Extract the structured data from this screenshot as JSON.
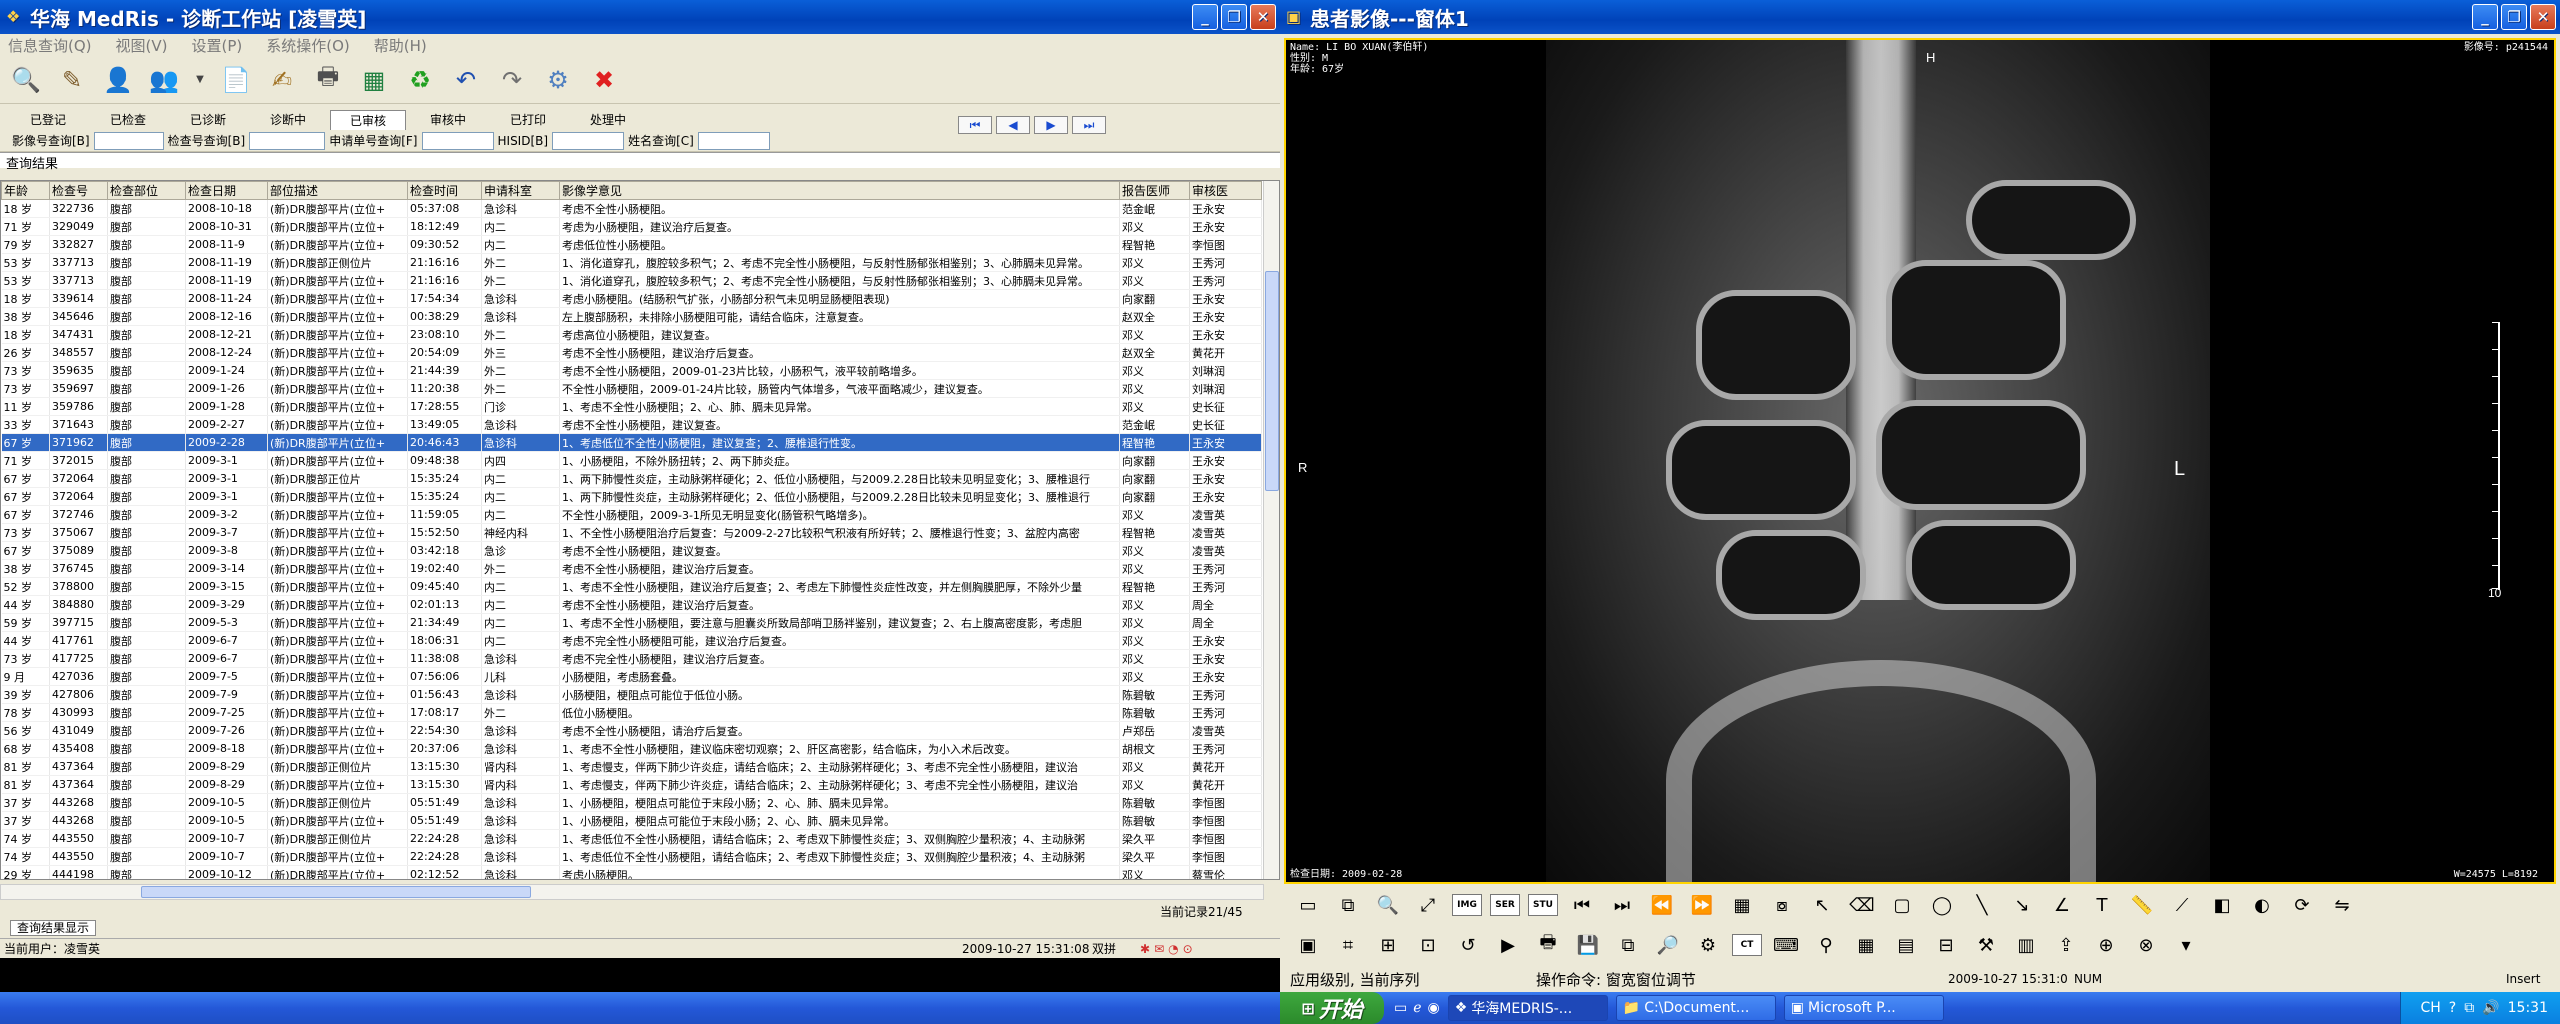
{
  "left_window": {
    "title": "华海 MedRis - 诊断工作站 [凌雪英]",
    "menu": [
      "信息查询(Q)",
      "视图(V)",
      "设置(P)",
      "系统操作(O)",
      "帮助(H)"
    ],
    "tabs": [
      "已登记",
      "已检查",
      "已诊断",
      "诊断中",
      "已审核",
      "审核中",
      "已打印",
      "处理中"
    ],
    "active_tab": "已审核",
    "search": {
      "label1": "影像号查询[B]",
      "label2": "检查号查询[B]",
      "label3": "申请单号查询[F]",
      "label4": "HISID[B]",
      "label5": "姓名查询[C]"
    },
    "result_label": "查询结果",
    "columns": [
      "年龄",
      "检查号",
      "检查部位",
      "检查日期",
      "部位描述",
      "检查时间",
      "申请科室",
      "影像学意见",
      "报告医师",
      "审核医"
    ],
    "rows": [
      [
        "18 岁",
        "322736",
        "腹部",
        "2008-10-18",
        "(新)DR腹部平片(立位+",
        "05:37:08",
        "急诊科",
        "考虑不全性小肠梗阻。",
        "范金岷",
        "王永安"
      ],
      [
        "71 岁",
        "329049",
        "腹部",
        "2008-10-31",
        "(新)DR腹部平片(立位+",
        "18:12:49",
        "内二",
        "考虑为小肠梗阻，建议治疗后复查。",
        "邓义",
        "王永安"
      ],
      [
        "79 岁",
        "332827",
        "腹部",
        "2008-11-9",
        "(新)DR腹部平片(立位+",
        "09:30:52",
        "内二",
        "考虑低位性小肠梗阻。",
        "程智艳",
        "李恒图"
      ],
      [
        "53 岁",
        "337713",
        "腹部",
        "2008-11-19",
        "(新)DR腹部正侧位片",
        "21:16:16",
        "外二",
        "1、消化道穿孔，腹腔较多积气；2、考虑不完全性小肠梗阻，与反射性肠郁张相鉴别；3、心肺膈未见异常。",
        "邓义",
        "王秀河"
      ],
      [
        "53 岁",
        "337713",
        "腹部",
        "2008-11-19",
        "(新)DR腹部平片(立位+",
        "21:16:16",
        "外二",
        "1、消化道穿孔，腹腔较多积气；2、考虑不完全性小肠梗阻，与反射性肠郁张相鉴别；3、心肺膈未见异常。",
        "邓义",
        "王秀河"
      ],
      [
        "18 岁",
        "339614",
        "腹部",
        "2008-11-24",
        "(新)DR腹部平片(立位+",
        "17:54:34",
        "急诊科",
        "考虑小肠梗阻。(结肠积气扩张，小肠部分积气未见明显肠梗阻表现)",
        "向家翻",
        "王永安"
      ],
      [
        "38 岁",
        "345646",
        "腹部",
        "2008-12-16",
        "(新)DR腹部平片(立位+",
        "00:38:29",
        "急诊科",
        "左上腹部肠积，未排除小肠梗阻可能，请结合临床，注意复查。",
        "赵双全",
        "王永安"
      ],
      [
        "18 岁",
        "347431",
        "腹部",
        "2008-12-21",
        "(新)DR腹部平片(立位+",
        "23:08:10",
        "外二",
        "考虑高位小肠梗阻，建议复查。",
        "邓义",
        "王永安"
      ],
      [
        "26 岁",
        "348557",
        "腹部",
        "2008-12-24",
        "(新)DR腹部平片(立位+",
        "20:54:09",
        "外三",
        "考虑不全性小肠梗阻，建议治疗后复查。",
        "赵双全",
        "黄花开"
      ],
      [
        "73 岁",
        "359635",
        "腹部",
        "2009-1-24",
        "(新)DR腹部平片(立位+",
        "21:44:39",
        "外二",
        "考虑不全性小肠梗阻，2009-01-23片比较，小肠积气，液平较前略增多。",
        "邓义",
        "刘琳润"
      ],
      [
        "73 岁",
        "359697",
        "腹部",
        "2009-1-26",
        "(新)DR腹部平片(立位+",
        "11:20:38",
        "外二",
        "不全性小肠梗阻，2009-01-24片比较，肠管内气体增多，气液平面略减少，建议复查。",
        "邓义",
        "刘琳润"
      ],
      [
        "11 岁",
        "359786",
        "腹部",
        "2009-1-28",
        "(新)DR腹部平片(立位+",
        "17:28:55",
        "门诊",
        "1、考虑不全性小肠梗阻；2、心、肺、膈未见异常。",
        "邓义",
        "史长征"
      ],
      [
        "33 岁",
        "371643",
        "腹部",
        "2009-2-27",
        "(新)DR腹部平片(立位+",
        "13:49:05",
        "急诊科",
        "考虑不全性小肠梗阻，建议复查。",
        "范金岷",
        "史长征"
      ],
      [
        "67 岁",
        "371962",
        "腹部",
        "2009-2-28",
        "(新)DR腹部平片(立位+",
        "20:46:43",
        "急诊科",
        "1、考虑低位不全性小肠梗阻，建议复查；2、腰椎退行性变。",
        "程智艳",
        "王永安"
      ],
      [
        "71 岁",
        "372015",
        "腹部",
        "2009-3-1",
        "(新)DR腹部平片(立位+",
        "09:48:38",
        "内四",
        "1、小肠梗阻，不除外肠扭转；2、两下肺炎症。",
        "向家翻",
        "王永安"
      ],
      [
        "67 岁",
        "372064",
        "腹部",
        "2009-3-1",
        "(新)DR腹部正位片",
        "15:35:24",
        "内二",
        "1、两下肺慢性炎症，主动脉粥样硬化；2、低位小肠梗阻，与2009.2.28日比较未见明显变化；3、腰椎退行",
        "向家翻",
        "王永安"
      ],
      [
        "67 岁",
        "372064",
        "腹部",
        "2009-3-1",
        "(新)DR腹部平片(立位+",
        "15:35:24",
        "内二",
        "1、两下肺慢性炎症，主动脉粥样硬化；2、低位小肠梗阻，与2009.2.28日比较未见明显变化；3、腰椎退行",
        "向家翻",
        "王永安"
      ],
      [
        "67 岁",
        "372746",
        "腹部",
        "2009-3-2",
        "(新)DR腹部平片(立位+",
        "11:59:05",
        "内二",
        "不全性小肠梗阻，2009-3-1所见无明显变化(肠管积气略增多)。",
        "邓义",
        "凌雪英"
      ],
      [
        "73 岁",
        "375067",
        "腹部",
        "2009-3-7",
        "(新)DR腹部平片(立位+",
        "15:52:50",
        "神经内科",
        "1、不全性小肠梗阻治疗后复查：与2009-2-27比较积气积液有所好转；2、腰椎退行性变；3、盆腔内高密",
        "程智艳",
        "凌雪英"
      ],
      [
        "67 岁",
        "375089",
        "腹部",
        "2009-3-8",
        "(新)DR腹部平片(立位+",
        "03:42:18",
        "急诊",
        "考虑不全性小肠梗阻，建议复查。",
        "邓义",
        "凌雪英"
      ],
      [
        "38 岁",
        "376745",
        "腹部",
        "2009-3-14",
        "(新)DR腹部平片(立位+",
        "19:02:40",
        "外二",
        "考虑不全性小肠梗阻，建议治疗后复查。",
        "邓义",
        "王秀河"
      ],
      [
        "52 岁",
        "378800",
        "腹部",
        "2009-3-15",
        "(新)DR腹部平片(立位+",
        "09:45:40",
        "内二",
        "1、考虑不全性小肠梗阻，建议治疗后复查；2、考虑左下肺慢性炎症性改变，并左侧胸膜肥厚，不除外少量",
        "程智艳",
        "王秀河"
      ],
      [
        "44 岁",
        "384880",
        "腹部",
        "2009-3-29",
        "(新)DR腹部平片(立位+",
        "02:01:13",
        "内二",
        "考虑不全性小肠梗阻，建议治疗后复查。",
        "邓义",
        "周全"
      ],
      [
        "59 岁",
        "397715",
        "腹部",
        "2009-5-3",
        "(新)DR腹部平片(立位+",
        "21:34:49",
        "内二",
        "1、考虑不全性小肠梗阻，要注意与胆囊炎所致局部哨卫肠袢鉴别，建议复查；2、右上腹高密度影，考虑胆",
        "邓义",
        "周全"
      ],
      [
        "44 岁",
        "417761",
        "腹部",
        "2009-6-7",
        "(新)DR腹部平片(立位+",
        "18:06:31",
        "内二",
        "考虑不完全性小肠梗阻可能，建议治疗后复查。",
        "邓义",
        "王永安"
      ],
      [
        "73 岁",
        "417725",
        "腹部",
        "2009-6-7",
        "(新)DR腹部平片(立位+",
        "11:38:08",
        "急诊科",
        "考虑不完全性小肠梗阻，建议治疗后复查。",
        "邓义",
        "王永安"
      ],
      [
        "9 月",
        "427036",
        "腹部",
        "2009-7-5",
        "(新)DR腹部平片(立位+",
        "07:56:06",
        "儿科",
        "小肠梗阻，考虑肠套叠。",
        "邓义",
        "王永安"
      ],
      [
        "39 岁",
        "427806",
        "腹部",
        "2009-7-9",
        "(新)DR腹部平片(立位+",
        "01:56:43",
        "急诊科",
        "小肠梗阻，梗阻点可能位于低位小肠。",
        "陈碧敏",
        "王秀河"
      ],
      [
        "78 岁",
        "430993",
        "腹部",
        "2009-7-25",
        "(新)DR腹部平片(立位+",
        "17:08:17",
        "外二",
        "低位小肠梗阻。",
        "陈碧敏",
        "王秀河"
      ],
      [
        "56 岁",
        "431049",
        "腹部",
        "2009-7-26",
        "(新)DR腹部平片(立位+",
        "22:54:30",
        "急诊科",
        "考虑不全性小肠梗阻，请治疗后复查。",
        "卢郑岳",
        "凌雪英"
      ],
      [
        "68 岁",
        "435408",
        "腹部",
        "2009-8-18",
        "(新)DR腹部平片(立位+",
        "20:37:06",
        "急诊科",
        "1、考虑不全性小肠梗阻，建议临床密切观察；2、肝区高密影，结合临床，为小入术后改变。",
        "胡根文",
        "王秀河"
      ],
      [
        "81 岁",
        "437364",
        "腹部",
        "2009-8-29",
        "(新)DR腹部正侧位片",
        "13:15:30",
        "肾内科",
        "1、考虑慢支，伴两下肺少许炎症，请结合临床；2、主动脉粥样硬化；3、考虑不完全性小肠梗阻，建议治",
        "邓义",
        "黄花开"
      ],
      [
        "81 岁",
        "437364",
        "腹部",
        "2009-8-29",
        "(新)DR腹部平片(立位+",
        "13:15:30",
        "肾内科",
        "1、考虑慢支，伴两下肺少许炎症，请结合临床；2、主动脉粥样硬化；3、考虑不完全性小肠梗阻，建议治",
        "邓义",
        "黄花开"
      ],
      [
        "37 岁",
        "443268",
        "腹部",
        "2009-10-5",
        "(新)DR腹部正侧位片",
        "05:51:49",
        "急诊科",
        "1、小肠梗阻，梗阻点可能位于末段小肠；2、心、肺、膈未见异常。",
        "陈碧敏",
        "李恒图"
      ],
      [
        "37 岁",
        "443268",
        "腹部",
        "2009-10-5",
        "(新)DR腹部平片(立位+",
        "05:51:49",
        "急诊科",
        "1、小肠梗阻，梗阻点可能位于末段小肠；2、心、肺、膈未见异常。",
        "陈碧敏",
        "李恒图"
      ],
      [
        "74 岁",
        "443550",
        "腹部",
        "2009-10-7",
        "(新)DR腹部正侧位片",
        "22:24:28",
        "急诊科",
        "1、考虑低位不全性小肠梗阻，请结合临床；2、考虑双下肺慢性炎症；3、双侧胸腔少量积液；4、主动脉粥",
        "梁久平",
        "李恒图"
      ],
      [
        "74 岁",
        "443550",
        "腹部",
        "2009-10-7",
        "(新)DR腹部平片(立位+",
        "22:24:28",
        "急诊科",
        "1、考虑低位不全性小肠梗阻，请结合临床；2、考虑双下肺慢性炎症；3、双侧胸腔少量积液；4、主动脉粥",
        "梁久平",
        "李恒图"
      ],
      [
        "29 岁",
        "444198",
        "腹部",
        "2009-10-12",
        "(新)DR腹部平片(立位+",
        "02:12:52",
        "急诊科",
        "考虑小肠梗阻。",
        "邓义",
        "蔡雪伦"
      ]
    ],
    "selected_row": 13,
    "row_count": "当前记录21/45",
    "bottom_tab": "查询结果显示",
    "status_user": "当前用户：凌雪英",
    "status_time": "2009-10-27 15:31:08",
    "status_ime": "双拼"
  },
  "right_window": {
    "title": "患者影像---窗体1",
    "overlay": {
      "name": "Name: LI BO XUAN(李伯轩)",
      "sex": "性别: M",
      "age": "年龄: 67岁",
      "series": "影像号: p241544",
      "exam_date": "检查日期: 2009-02-28",
      "window": "W=24575 L=8192",
      "marker_h": "H",
      "marker_r": "R",
      "marker_l": "L",
      "scale_label": "10"
    },
    "status_level": "应用级别, 当前序列",
    "status_cmd": "操作命令: 窗宽窗位调节",
    "status_time": "2009-10-27 15:31:0",
    "status_num": "NUM",
    "status_ins": "Insert"
  },
  "taskbar": {
    "start": "开始",
    "tasks": [
      "华海MEDRIS-...",
      "C:\\Document...",
      "Microsoft P..."
    ],
    "clock": "15:31",
    "ime": "CH"
  }
}
